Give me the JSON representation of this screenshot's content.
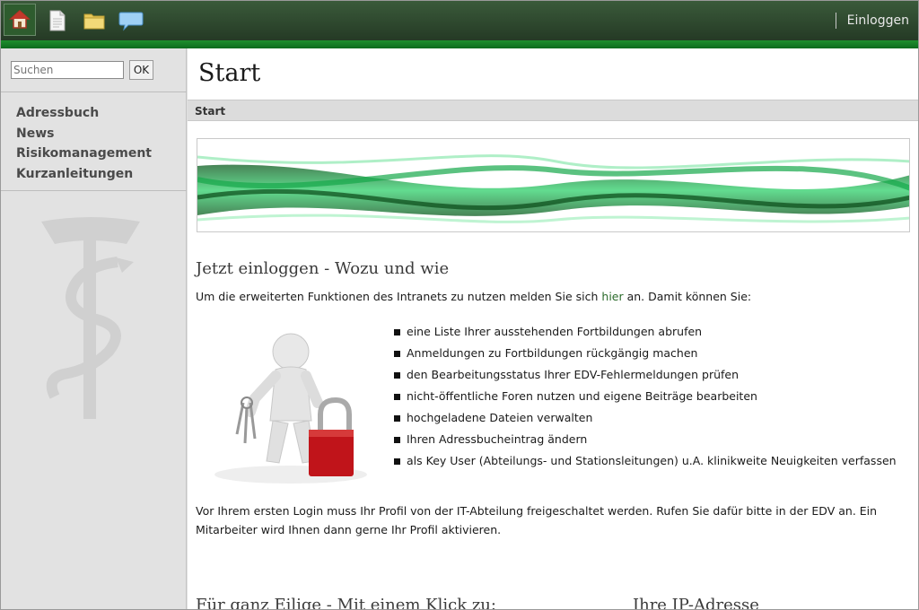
{
  "topbar": {
    "icons": [
      "home-icon",
      "page-icon",
      "folder-icon",
      "chat-icon"
    ],
    "login_label": "Einloggen"
  },
  "sidebar": {
    "search_placeholder": "Suchen",
    "ok_label": "OK",
    "items": [
      {
        "label": "Adressbuch"
      },
      {
        "label": "News"
      },
      {
        "label": "Risikomanagement"
      },
      {
        "label": "Kurzanleitungen"
      }
    ]
  },
  "main": {
    "title": "Start",
    "breadcrumb": "Start",
    "section_heading": "Jetzt einloggen - Wozu und wie",
    "intro_before": "Um die erweiterten Funktionen des Intranets zu nutzen melden Sie sich ",
    "intro_link": "hier",
    "intro_after": " an. Damit können Sie:",
    "bullets": [
      "eine Liste Ihrer ausstehenden Fortbildungen abrufen",
      "Anmeldungen zu Fortbildungen rückgängig machen",
      "den Bearbeitungsstatus Ihrer EDV-Fehlermeldungen prüfen",
      "nicht-öffentliche Foren nutzen und eigene Beiträge bearbeiten",
      "hochgeladene Dateien verwalten",
      "Ihren Adressbucheintrag ändern",
      "als Key User (Abteilungs- und Stationsleitungen) u.A. klinikweite Neuigkeiten verfassen"
    ],
    "note": "Vor Ihrem ersten Login muss Ihr Profil von der IT-Abteilung freigeschaltet werden. Rufen Sie dafür bitte in der EDV an. Ein Mitarbeiter wird Ihnen dann gerne Ihr Profil aktivieren.",
    "heading_quick": "Für ganz Eilige - Mit einem Klick zu:",
    "heading_ip": "Ihre IP-Adresse"
  },
  "colors": {
    "topbar": "#2e4a2e",
    "accent_green": "#0d7a20",
    "link": "#2b6b2b"
  }
}
